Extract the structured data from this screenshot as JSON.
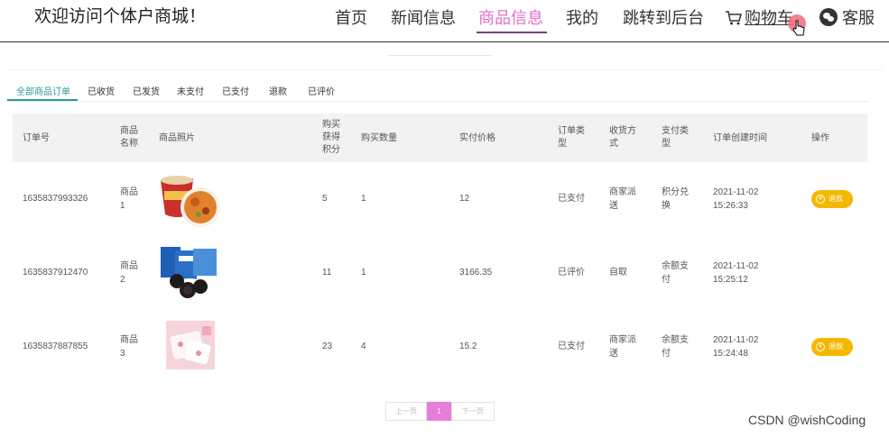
{
  "header": {
    "title": "欢迎访问个体户商城！",
    "nav": [
      "首页",
      "新闻信息",
      "商品信息",
      "我的",
      "跳转到后台"
    ],
    "cart_label": "购物车",
    "service_label": "客服"
  },
  "tabs": [
    "全部商品订单",
    "已收货",
    "已发货",
    "未支付",
    "已支付",
    "退款",
    "已评价"
  ],
  "table": {
    "headers": {
      "order_no": "订单号",
      "name": [
        "商品",
        "名称"
      ],
      "photo": "商品照片",
      "points": [
        "购买",
        "获得",
        "积分"
      ],
      "qty": "购买数量",
      "price": "实付价格",
      "order_type": [
        "订单类",
        "型"
      ],
      "delivery": [
        "收货方",
        "式"
      ],
      "pay_type": [
        "支付类",
        "型"
      ],
      "created": "订单创建时间",
      "action": "操作"
    },
    "rows": [
      {
        "order_no": "1635837993326",
        "name": [
          "商品",
          "1"
        ],
        "image": "instant-noodle-cup",
        "points": "5",
        "qty": "1",
        "price": "12",
        "order_type": "已支付",
        "delivery": [
          "商家派",
          "送"
        ],
        "pay_type": [
          "积分兑",
          "换"
        ],
        "created": [
          "2021-11-02",
          "15:26:33"
        ],
        "action": "退款"
      },
      {
        "order_no": "1635837912470",
        "name": [
          "商品",
          "2"
        ],
        "image": "oreo-cookies",
        "points": "11",
        "qty": "1",
        "price": "3166.35",
        "order_type": "已评价",
        "delivery": [
          "自取"
        ],
        "pay_type": [
          "余额支",
          "付"
        ],
        "created": [
          "2021-11-02",
          "15:25:12"
        ],
        "action": ""
      },
      {
        "order_no": "1635837887855",
        "name": [
          "商品",
          "3"
        ],
        "image": "pink-snack-pack",
        "points": "23",
        "qty": "4",
        "price": "15.2",
        "order_type": "已支付",
        "delivery": [
          "商家派",
          "送"
        ],
        "pay_type": [
          "余额支",
          "付"
        ],
        "created": [
          "2021-11-02",
          "15:24:48"
        ],
        "action": "退款"
      }
    ]
  },
  "pagination": {
    "prev": "上一页",
    "current": "1",
    "next": "下一页"
  },
  "watermark": "CSDN @wishCoding",
  "colors": {
    "accent_pink": "#e070c8",
    "tab_green": "#2f9a93",
    "refund_yellow": "#f5b800"
  }
}
